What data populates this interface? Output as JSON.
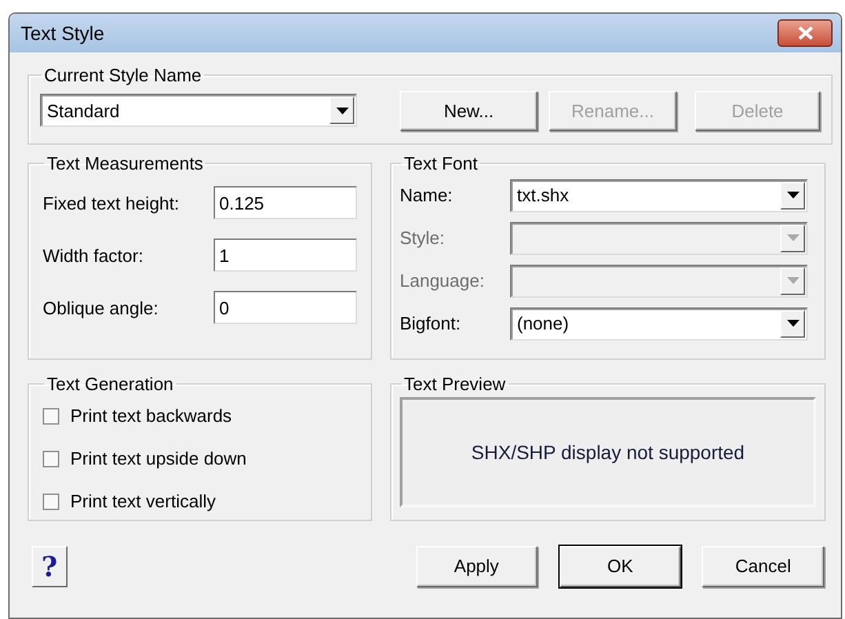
{
  "window": {
    "title": "Text Style"
  },
  "current_style": {
    "label": "Current Style Name",
    "value": "Standard",
    "buttons": [
      {
        "label": "New...",
        "disabled": false
      },
      {
        "label": "Rename...",
        "disabled": true
      },
      {
        "label": "Delete",
        "disabled": true
      }
    ]
  },
  "measurements": {
    "label": "Text Measurements",
    "fields": [
      {
        "label": "Fixed text height:",
        "value": "0.125"
      },
      {
        "label": "Width factor:",
        "value": "1"
      },
      {
        "label": "Oblique angle:",
        "value": "0"
      }
    ]
  },
  "font": {
    "label": "Text Font",
    "fields": [
      {
        "label": "Name:",
        "value": "txt.shx",
        "disabled": false
      },
      {
        "label": "Style:",
        "disabled": true
      },
      {
        "label": "Language:",
        "disabled": true
      },
      {
        "label": "Bigfont:",
        "value": "(none)",
        "disabled": false
      }
    ]
  },
  "generation": {
    "label": "Text Generation",
    "options": [
      {
        "label": "Print text backwards",
        "checked": false
      },
      {
        "label": "Print text upside down",
        "checked": false
      },
      {
        "label": "Print text vertically",
        "checked": false
      }
    ]
  },
  "preview": {
    "label": "Text Preview",
    "message": "SHX/SHP display not supported"
  },
  "help_button": "?",
  "buttons": [
    {
      "label": "Apply",
      "default": false
    },
    {
      "label": "OK",
      "default": true
    },
    {
      "label": "Cancel",
      "default": false
    }
  ]
}
